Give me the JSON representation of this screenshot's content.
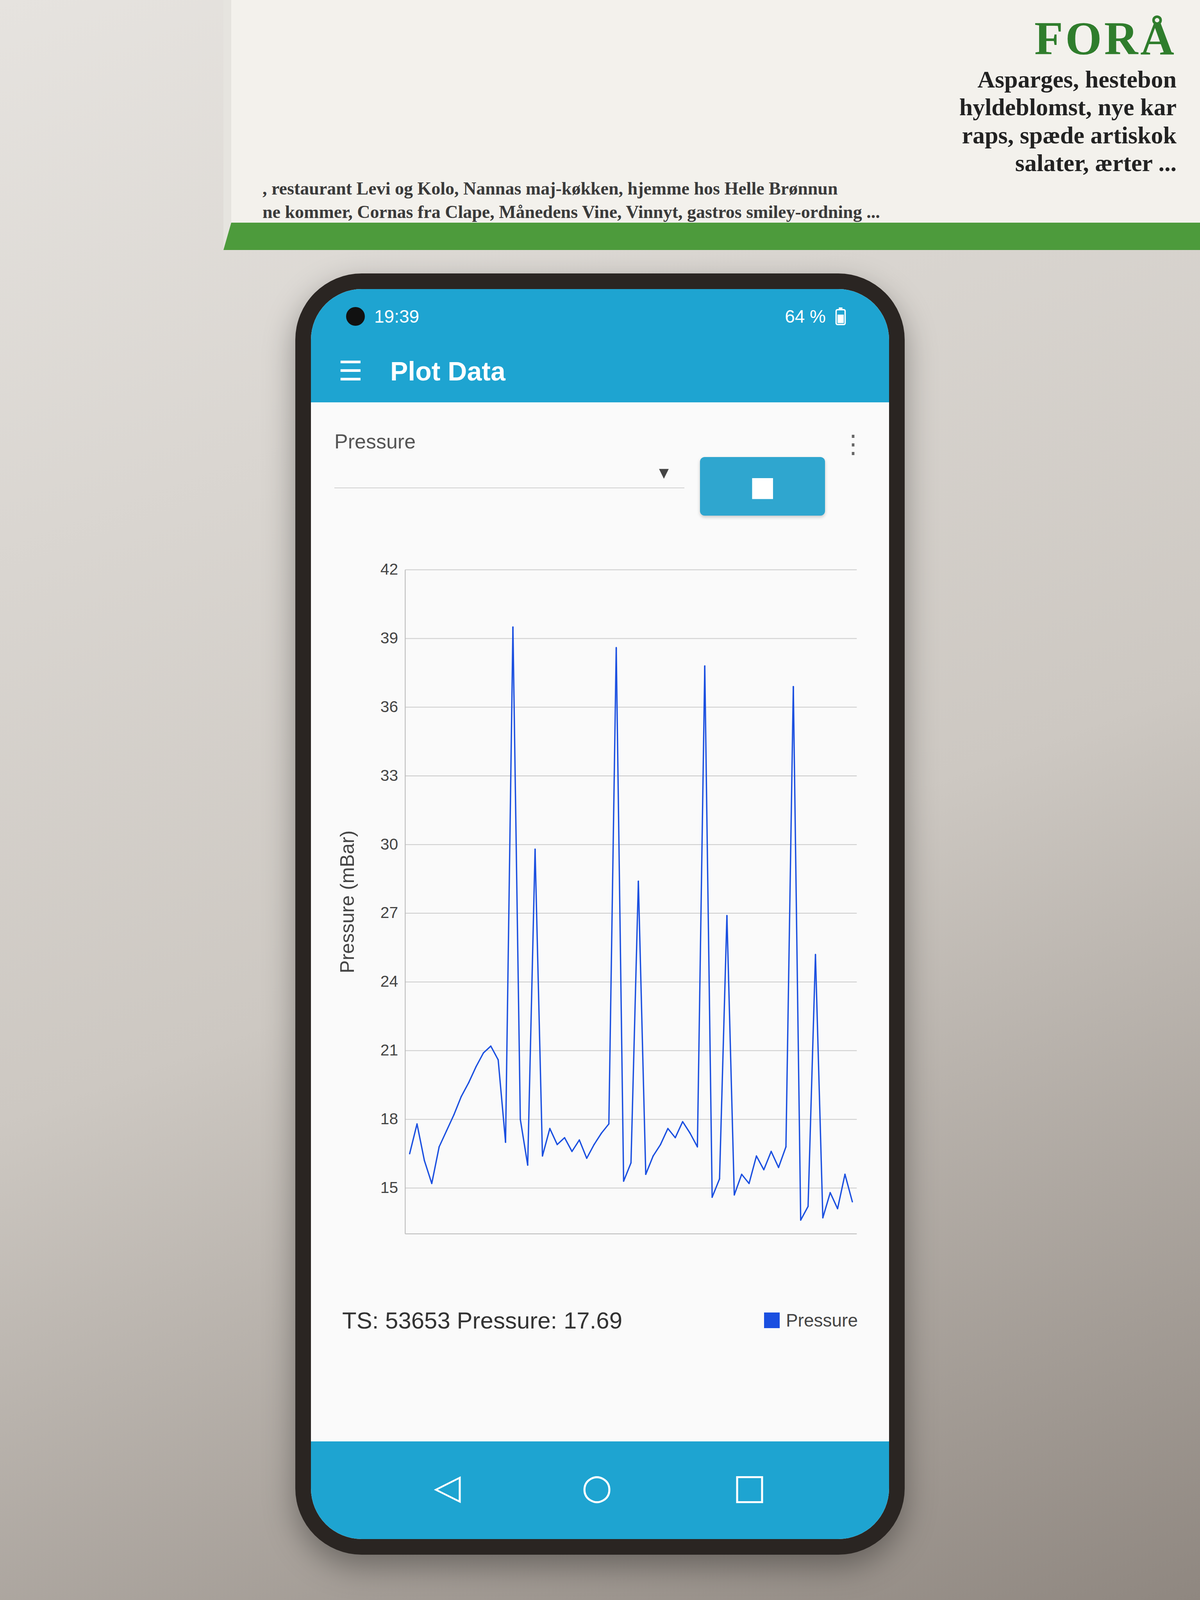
{
  "magazine": {
    "title": "FORÅ",
    "headline_lines": [
      "Asparges, hestebon",
      "hyldeblomst, nye kar",
      "raps, spæde artiskok",
      "salater, ærter ..."
    ],
    "caption_lines": [
      ", restaurant Levi og Kolo, Nannas maj-køkken, hjemme hos Helle Brønnun",
      "ne kommer, Cornas fra Clape, Månedens Vine, Vinnyt, gastros smiley-ordning ..."
    ]
  },
  "status_bar": {
    "time": "19:39",
    "battery": "64 %"
  },
  "app_bar": {
    "menu_icon": "☰",
    "title": "Plot Data",
    "more_icon": "⋮"
  },
  "chart": {
    "selector": {
      "label": "Pressure",
      "arrow": "▾"
    },
    "stop_button": {
      "label": "■"
    },
    "y_axis": {
      "label": "Pressure (mBar)",
      "ticks": [
        "15",
        "18",
        "21",
        "24",
        "27",
        "30",
        "33",
        "36",
        "39",
        "42"
      ]
    },
    "series": [
      {
        "name": "Pressure",
        "values": [
          16.5,
          17.8,
          16.2,
          15.2,
          16.8,
          17.5,
          18.2,
          19,
          19.6,
          20.3,
          20.9,
          21.2,
          20.6,
          17,
          39.5,
          18,
          16,
          29.8,
          16.4,
          17.6,
          16.9,
          17.2,
          16.6,
          17.1,
          16.3,
          16.9,
          17.4,
          17.8,
          38.6,
          15.3,
          16.1,
          28.4,
          15.6,
          16.4,
          16.9,
          17.6,
          17.2,
          17.9,
          17.4,
          16.8,
          37.8,
          14.6,
          15.4,
          26.9,
          14.7,
          15.6,
          15.2,
          16.4,
          15.8,
          16.6,
          15.9,
          16.8,
          36.9,
          13.6,
          14.2,
          25.2,
          13.7,
          14.8,
          14.1,
          15.6,
          14.4
        ]
      }
    ],
    "legend": [
      {
        "label": "Pressure",
        "color": "#1a4fe0"
      }
    ],
    "readout": "TS: 53653 Pressure: 17.69"
  },
  "nav_bar": {
    "buttons": [
      "◁",
      "○",
      "□"
    ]
  }
}
